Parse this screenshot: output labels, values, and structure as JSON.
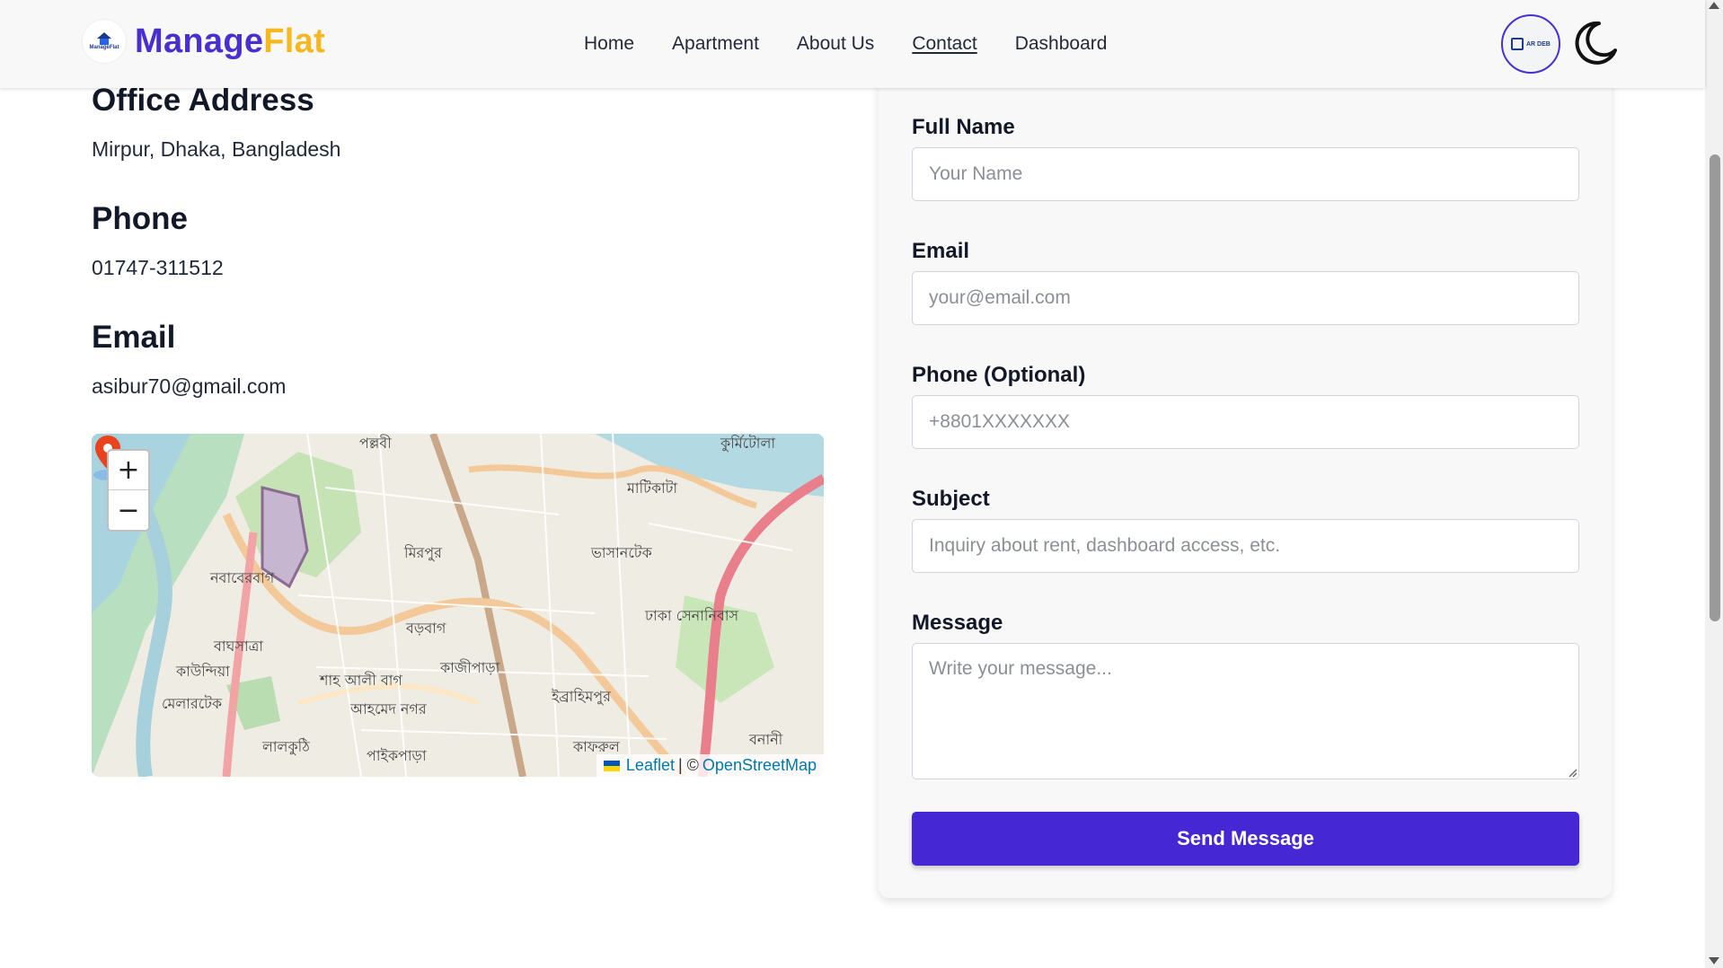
{
  "brand": {
    "logo_text": "ManageFlat",
    "name_part1": "Manage",
    "name_part2": "Flat"
  },
  "nav": {
    "items": [
      {
        "label": "Home"
      },
      {
        "label": "Apartment"
      },
      {
        "label": "About Us"
      },
      {
        "label": "Contact",
        "active": true
      },
      {
        "label": "Dashboard"
      }
    ]
  },
  "header_right": {
    "avatar_text": "AR DEB",
    "theme_toggle_icon": "moon-icon"
  },
  "contact_info": {
    "office_title": "Office Address",
    "office_value": "Mirpur, Dhaka, Bangladesh",
    "phone_title": "Phone",
    "phone_value": "01747-311512",
    "email_title": "Email",
    "email_value": "asibur70@gmail.com"
  },
  "map": {
    "zoom_in": "+",
    "zoom_out": "−",
    "attribution_leaflet": "Leaflet",
    "attribution_sep": "| ©",
    "attribution_osm": "OpenStreetMap",
    "labels": [
      {
        "text": "পল্লবী"
      },
      {
        "text": "কুর্মিটোলা"
      },
      {
        "text": "মাটিকাটা"
      },
      {
        "text": "মিরপুর"
      },
      {
        "text": "ভাসানটেক"
      },
      {
        "text": "নবাবেরবাগ"
      },
      {
        "text": "ঢাকা সেনানিবাস"
      },
      {
        "text": "বড়বাগ"
      },
      {
        "text": "বাঘসাত্রা"
      },
      {
        "text": "কাউন্দিয়া"
      },
      {
        "text": "শাহ আলী বাগ"
      },
      {
        "text": "কাজীপাড়া"
      },
      {
        "text": "ইব্রাহিমপুর"
      },
      {
        "text": "মেলারটেক"
      },
      {
        "text": "আহমেদ নগর"
      },
      {
        "text": "লালকুঠি"
      },
      {
        "text": "পাইকপাড়া"
      },
      {
        "text": "কাফরুল"
      },
      {
        "text": "বনানী"
      }
    ]
  },
  "form": {
    "full_name_label": "Full Name",
    "full_name_placeholder": "Your Name",
    "email_label": "Email",
    "email_placeholder": "your@email.com",
    "phone_label": "Phone (Optional)",
    "phone_placeholder": "+8801XXXXXXX",
    "subject_label": "Subject",
    "subject_placeholder": "Inquiry about rent, dashboard access, etc.",
    "message_label": "Message",
    "message_placeholder": "Write your message...",
    "submit_label": "Send Message"
  },
  "colors": {
    "brand_primary": "#4527d4",
    "brand_accent": "#f5b820",
    "map_pin": "#e8431c"
  }
}
